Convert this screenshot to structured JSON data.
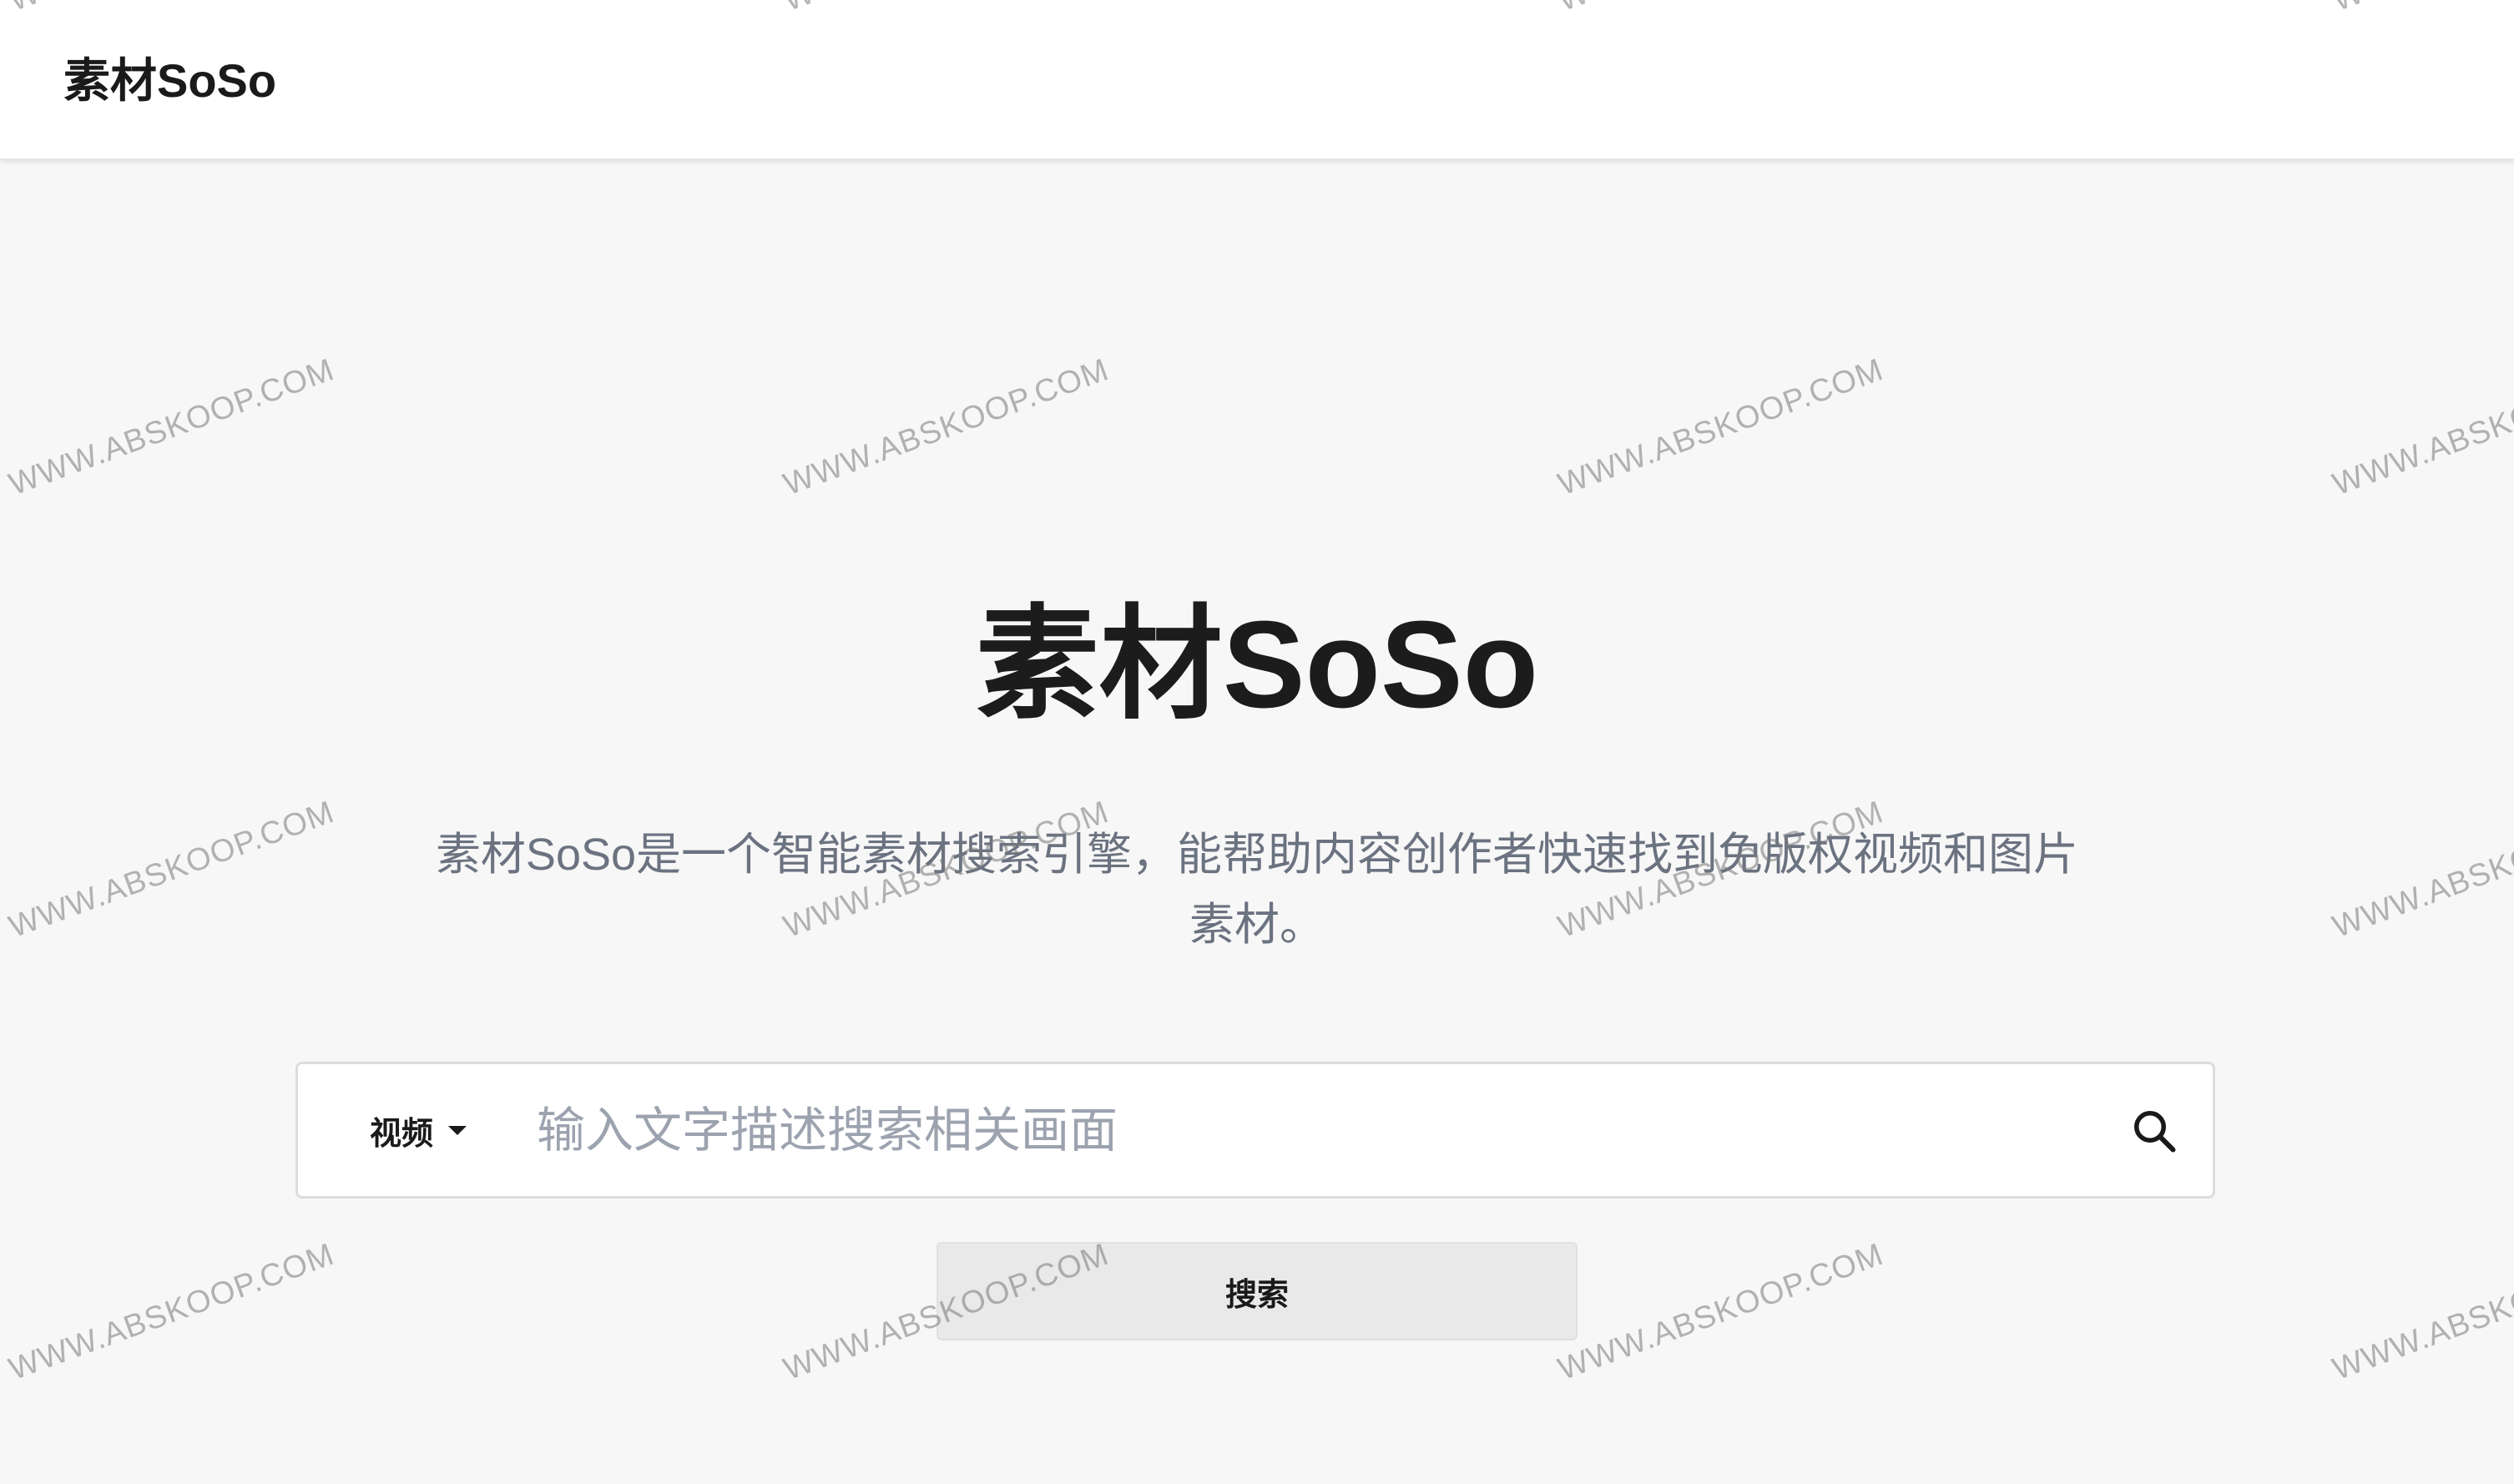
{
  "header": {
    "brand": "素材SoSo"
  },
  "hero": {
    "title": "素材SoSo",
    "description": "素材SoSo是一个智能素材搜索引擎，能帮助内容创作者快速找到免版权视频和图片素材。"
  },
  "search": {
    "type_label": "视频",
    "placeholder": "输入文字描述搜索相关画面",
    "value": "",
    "button_label": "搜索"
  },
  "watermark": {
    "text": "WWW.ABSKOOP.COM"
  },
  "colors": {
    "page_background": "#f7f7f7",
    "header_background": "#ffffff",
    "description_text": "#6b7280",
    "placeholder_text": "#9ca3af",
    "button_background": "#e9e9e9"
  },
  "icons": {
    "search": "search-icon",
    "dropdown": "caret-down-icon"
  }
}
